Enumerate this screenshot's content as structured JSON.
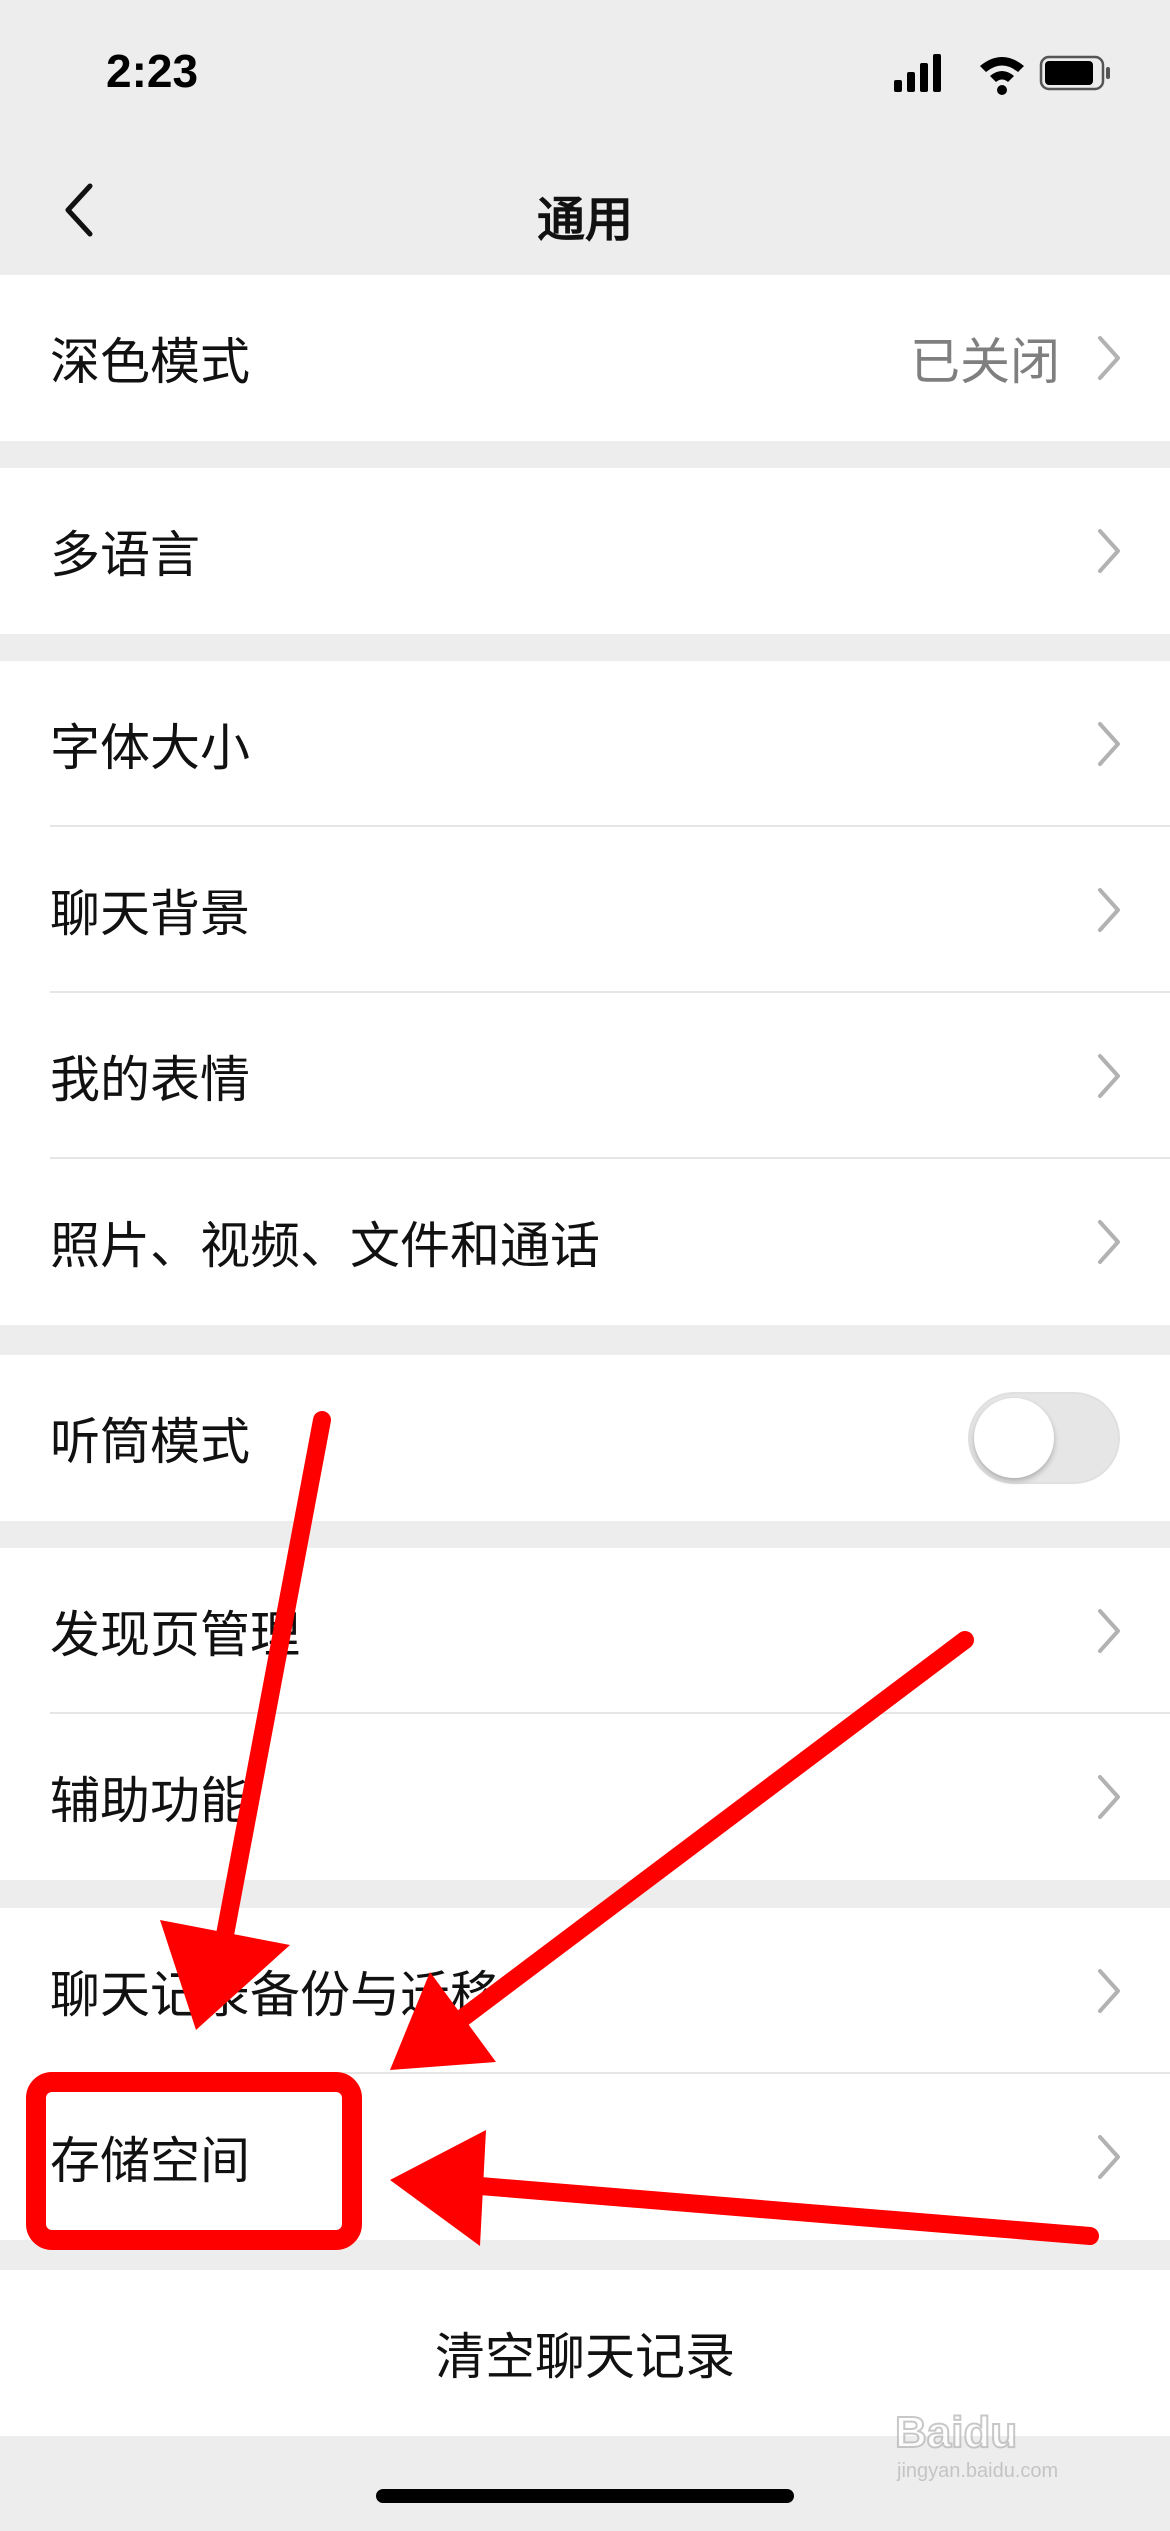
{
  "status_bar": {
    "time": "2:23"
  },
  "nav": {
    "title": "通用"
  },
  "groups": [
    {
      "rows": [
        {
          "label": "深色模式",
          "value": "已关闭"
        }
      ]
    },
    {
      "rows": [
        {
          "label": "多语言"
        }
      ]
    },
    {
      "rows": [
        {
          "label": "字体大小"
        },
        {
          "label": "聊天背景"
        },
        {
          "label": "我的表情"
        },
        {
          "label": "照片、视频、文件和通话"
        }
      ]
    },
    {
      "rows": [
        {
          "label": "听筒模式",
          "toggle": false
        }
      ]
    },
    {
      "rows": [
        {
          "label": "发现页管理"
        },
        {
          "label": "辅助功能"
        }
      ]
    },
    {
      "rows": [
        {
          "label": "聊天记录备份与迁移"
        },
        {
          "label": "存储空间"
        }
      ]
    }
  ],
  "clear_chat": "清空聊天记录",
  "annotation_color": "#ff0000",
  "watermark": {
    "brand": "Baidu",
    "sub": "jingyan.baidu.com"
  },
  "icons": [
    "back-icon",
    "chevron-right-icon",
    "signal-icon",
    "wifi-icon",
    "battery-icon"
  ]
}
